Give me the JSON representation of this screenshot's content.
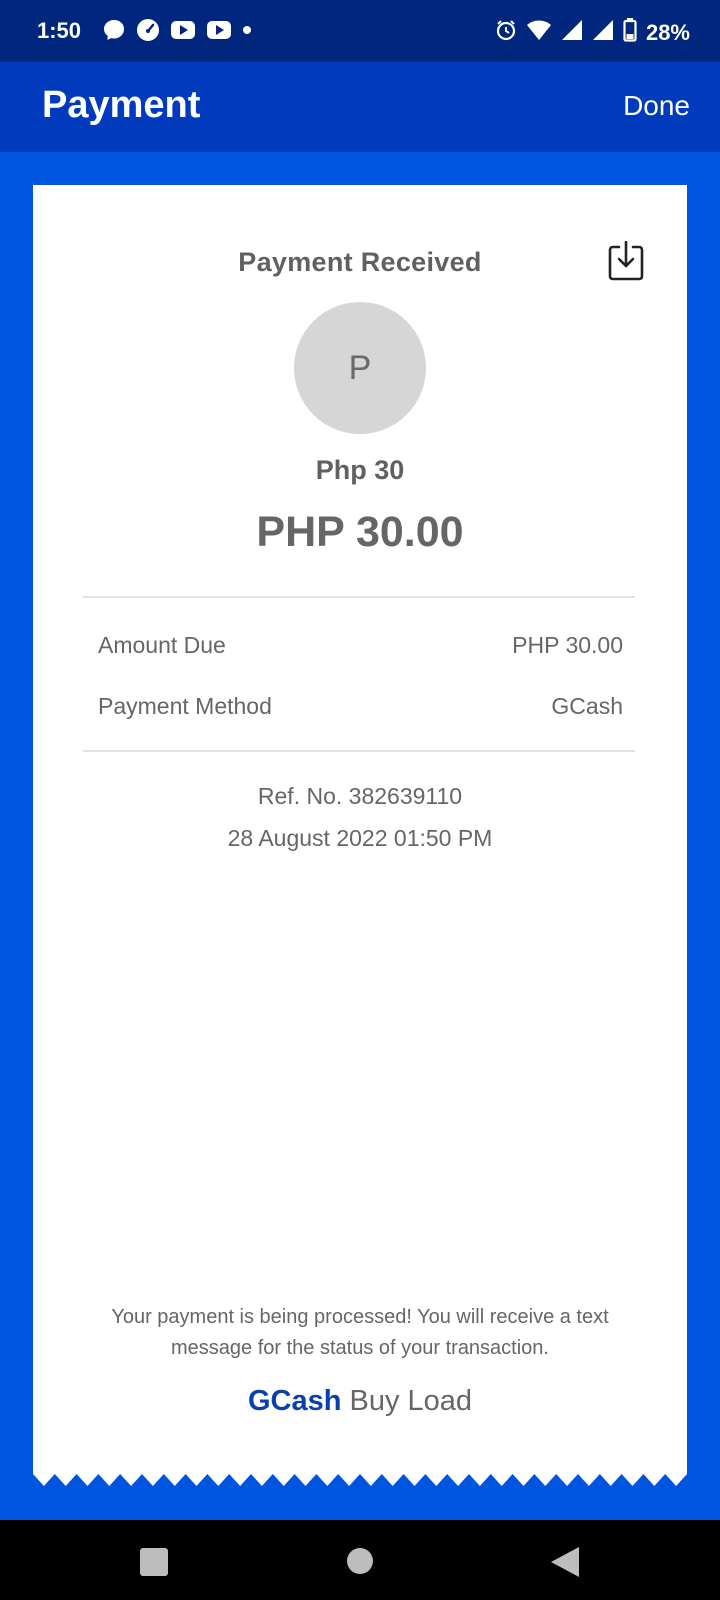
{
  "status_bar": {
    "time": "1:50",
    "battery": "28%",
    "left_icons": [
      "messenger-icon",
      "speedometer-icon",
      "youtube-icon",
      "youtube-icon",
      "dot-icon"
    ],
    "right_icons": [
      "alarm-icon",
      "wifi-icon",
      "signal-icon",
      "signal-icon",
      "battery-icon"
    ]
  },
  "header": {
    "title": "Payment",
    "done_label": "Done"
  },
  "receipt": {
    "title": "Payment Received",
    "avatar_initial": "P",
    "name": "Php 30",
    "amount": "PHP 30.00",
    "rows": [
      {
        "label": "Amount Due",
        "value": "PHP 30.00"
      },
      {
        "label": "Payment Method",
        "value": "GCash"
      }
    ],
    "ref_no": "Ref. No. 382639110",
    "datetime": "28 August 2022 01:50 PM",
    "note": "Your payment is being processed! You will receive a text message for the status of your transaction.",
    "brand": "GCash",
    "brand_suffix": " Buy Load"
  },
  "colors": {
    "background": "#0055E0",
    "status_bar": "#00267E",
    "app_bar": "#003BBE",
    "brand_blue": "#0A3FB0"
  }
}
